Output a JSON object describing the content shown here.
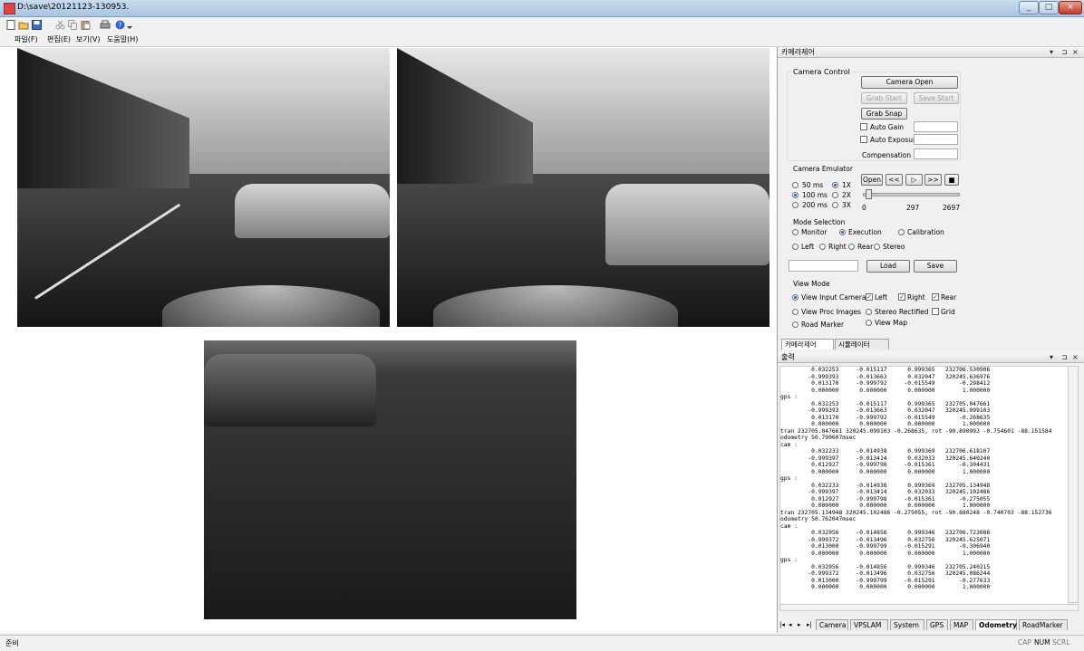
{
  "window": {
    "title": "D:\\save\\20121123-130953.",
    "controls": [
      "_",
      "□",
      "×"
    ]
  },
  "toolbar": {
    "icons": [
      "new-icon",
      "open-icon",
      "save-icon",
      "cut-icon",
      "copy-icon",
      "paste-icon",
      "print-icon",
      "help-icon",
      "dropdown-icon"
    ]
  },
  "menu": {
    "items": [
      "파일(F)",
      "편집(E)",
      "보기(V)",
      "도움말(H)"
    ]
  },
  "camera_panel": {
    "title": "카메라제어",
    "pin_icons": [
      "▾",
      "⊐",
      "×"
    ],
    "camera_control": {
      "label": "Camera Control",
      "camera_open": "Camera Open",
      "grab_start": "Grab Start",
      "save_start": "Save Start",
      "grab_snap": "Grab Snap",
      "auto_gain": "Auto Gain",
      "auto_exposure": "Auto Exposure",
      "compensation": "Compensation"
    },
    "emulator": {
      "label": "Camera Emulator",
      "rates": [
        "50 ms",
        "100 ms",
        "200 ms"
      ],
      "selected_rate": "100 ms",
      "speeds": [
        "1X",
        "2X",
        "3X"
      ],
      "selected_speed": "1X",
      "open": "Open",
      "rewind": "<<",
      "play": "▷",
      "forward": ">>",
      "stop": "■",
      "slider_min": "0",
      "slider_current": "297",
      "slider_max": "2697",
      "slider_fraction": 0.03
    },
    "mode": {
      "label": "Mode Selection",
      "modes": [
        "Monitor",
        "Execution",
        "Calibration"
      ],
      "selected_mode": "Execution",
      "cams": [
        "Left",
        "Right",
        "Rear",
        "Stereo"
      ],
      "load": "Load",
      "save": "Save"
    },
    "view_mode": {
      "label": "View Mode",
      "view_input": "View Input Cameras",
      "left": "Left",
      "right": "Right",
      "rear": "Rear",
      "view_proc": "View Proc Images",
      "stereo_rectified": "Stereo Rectified",
      "grid": "Grid",
      "road_marker": "Road Marker",
      "view_map": "View Map"
    },
    "tabs": [
      "카메라제어",
      "시뮬레이터"
    ]
  },
  "output_panel": {
    "title": "출력",
    "lines": [
      "         0.032253     -0.015117      0.999365   232706.530906",
      "        -0.999393     -0.013663      0.032047   320245.636976",
      "         0.013170     -0.999792     -0.015549       -0.298412",
      "         0.000000      0.000000      0.000000        1.000000",
      "gps :",
      "         0.032253     -0.015117      0.999365   232705.047661",
      "        -0.999393     -0.013663      0.032047   320245.099103",
      "         0.013170     -0.999792     -0.015549       -0.268635",
      "         0.000000      0.000000      0.000000        1.000000",
      "tran 232705.047661 320245.099103 -0.268635, rot -90.890993 -0.754601 -88.151584",
      "odometry 50.790607msec",
      "cam :",
      "         0.032233     -0.014938      0.999369   232706.618107",
      "        -0.999397     -0.013414      0.032033   320245.640240",
      "         0.012927     -0.999798     -0.015361       -0.304431",
      "         0.000000      0.000000      0.000000        1.000000",
      "gps :",
      "         0.032233     -0.014938      0.999369   232705.134948",
      "        -0.999397     -0.013414      0.032033   320245.102486",
      "         0.012927     -0.999798     -0.015361       -0.275055",
      "         0.000000      0.000000      0.000000        1.000000",
      "tran 232705.134948 320245.102486 -0.275055, rot -90.880248 -0.740703 -88.152736",
      "odometry 50.762047msec",
      "cam :",
      "         0.032956     -0.014856      0.999346   232706.723086",
      "        -0.999372     -0.013496      0.032756   320245.625071",
      "         0.013000     -0.999799     -0.015291       -0.306940",
      "         0.000000      0.000000      0.000000        1.000000",
      "gps :",
      "         0.032956     -0.014856      0.999346   232705.240215",
      "        -0.999372     -0.013496      0.032756   320245.086244",
      "         0.013000     -0.999799     -0.015291       -0.277633",
      "         0.000000      0.000000      0.000000        1.000000"
    ],
    "tabs": [
      "Camera",
      "VPSLAM",
      "System",
      "GPS",
      "MAP",
      "Odometry",
      "RoadMarker"
    ],
    "active_tab": "Odometry",
    "nav": [
      "|◂",
      "◂",
      "▸",
      "▸|"
    ]
  },
  "status": {
    "text": "준비",
    "indicators": [
      "CAP",
      "NUM",
      "SCRL"
    ]
  }
}
